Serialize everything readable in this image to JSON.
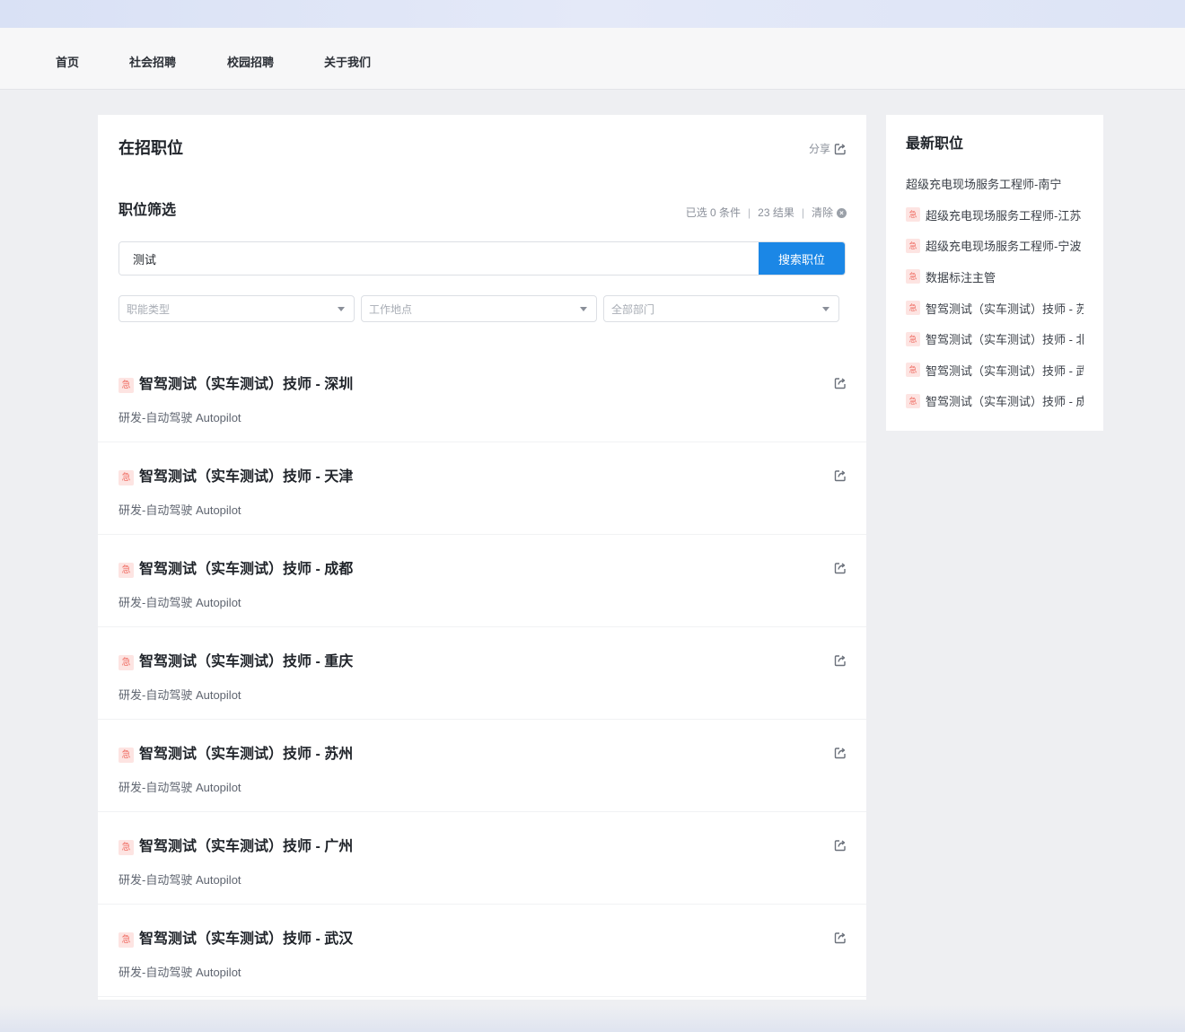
{
  "nav": {
    "items": [
      {
        "label": "首页"
      },
      {
        "label": "社会招聘"
      },
      {
        "label": "校园招聘"
      },
      {
        "label": "关于我们"
      }
    ]
  },
  "main": {
    "title": "在招职位",
    "share_label": "分享",
    "filter": {
      "title": "职位筛选",
      "selected_text": "已选 0 条件",
      "results_text": "23 结果",
      "clear_label": "清除"
    },
    "search": {
      "value": "测试",
      "button_label": "搜索职位"
    },
    "selects": [
      {
        "placeholder": "职能类型"
      },
      {
        "placeholder": "工作地点"
      },
      {
        "placeholder": "全部部门"
      }
    ],
    "urgent_badge": "急",
    "jobs": [
      {
        "title": "智驾测试（实车测试）技师 - 深圳",
        "dept": "研发-自动驾驶 Autopilot"
      },
      {
        "title": "智驾测试（实车测试）技师 - 天津",
        "dept": "研发-自动驾驶 Autopilot"
      },
      {
        "title": "智驾测试（实车测试）技师 - 成都",
        "dept": "研发-自动驾驶 Autopilot"
      },
      {
        "title": "智驾测试（实车测试）技师 - 重庆",
        "dept": "研发-自动驾驶 Autopilot"
      },
      {
        "title": "智驾测试（实车测试）技师 - 苏州",
        "dept": "研发-自动驾驶 Autopilot"
      },
      {
        "title": "智驾测试（实车测试）技师 - 广州",
        "dept": "研发-自动驾驶 Autopilot"
      },
      {
        "title": "智驾测试（实车测试）技师 - 武汉",
        "dept": "研发-自动驾驶 Autopilot"
      }
    ]
  },
  "sidebar": {
    "title": "最新职位",
    "items": [
      {
        "label": "超级充电现场服务工程师-南宁",
        "urgent": false
      },
      {
        "label": "超级充电现场服务工程师-江苏",
        "urgent": true
      },
      {
        "label": "超级充电现场服务工程师-宁波",
        "urgent": true
      },
      {
        "label": "数据标注主管",
        "urgent": true
      },
      {
        "label": "智驾测试（实车测试）技师 - 苏州",
        "urgent": true
      },
      {
        "label": "智驾测试（实车测试）技师 - 北京",
        "urgent": true
      },
      {
        "label": "智驾测试（实车测试）技师 - 武汉",
        "urgent": true
      },
      {
        "label": "智驾测试（实车测试）技师 - 成都",
        "urgent": true
      }
    ]
  },
  "colors": {
    "accent": "#1b87e6",
    "urgent_bg": "#fde4e2",
    "urgent_fg": "#f07167"
  },
  "icons": {
    "share": "share-icon",
    "clear": "clear-icon",
    "caret": "caret-down-icon"
  }
}
